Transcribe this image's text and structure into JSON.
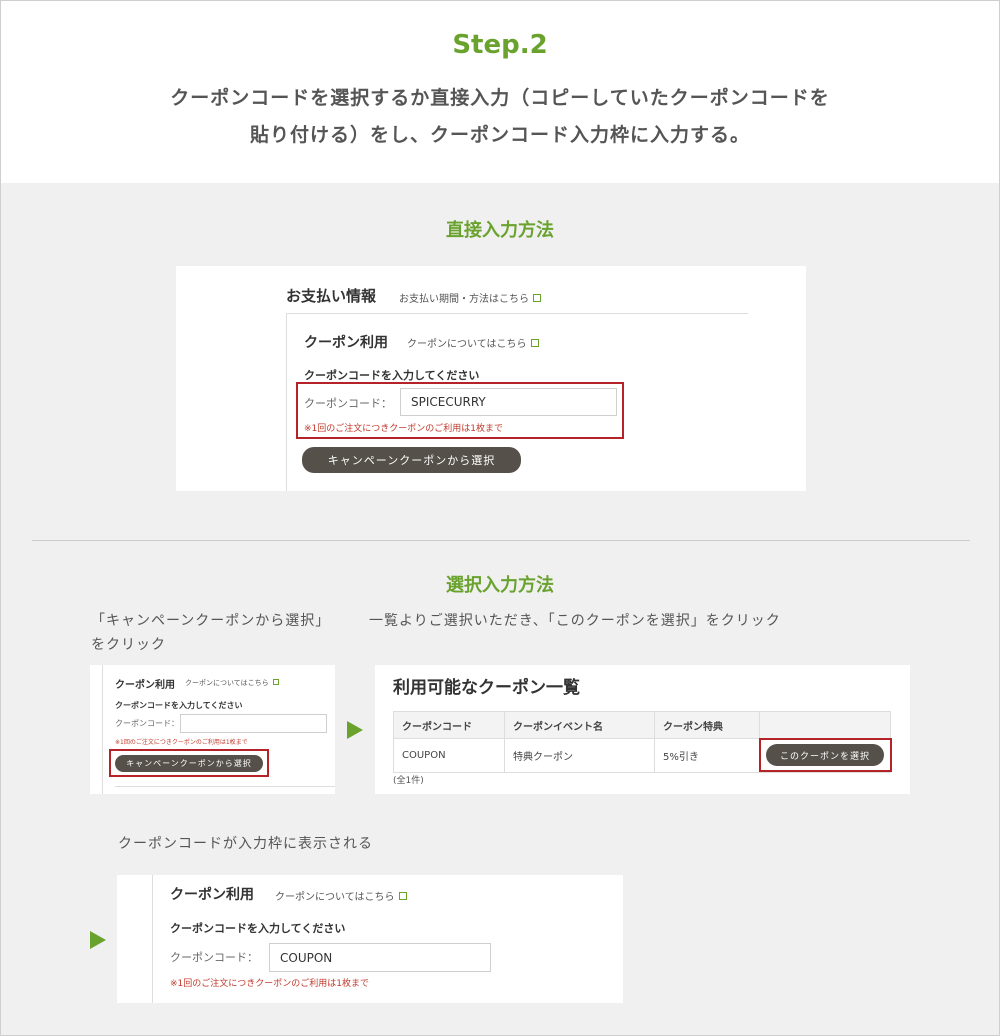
{
  "header": {
    "step": "Step.2",
    "intro_line1": "クーポンコードを選択するか直接入力（コピーしていたクーポンコードを",
    "intro_line2": "貼り付ける）をし、クーポンコード入力枠に入力する。"
  },
  "direct": {
    "title": "直接入力方法",
    "payment_title": "お支払い情報",
    "payment_link": "お支払い期間・方法はこちら",
    "coupon_title": "クーポン利用",
    "coupon_link": "クーポンについてはこちら",
    "prompt": "クーポンコードを入力してください",
    "field_label": "クーポンコード：",
    "field_value": "SPICECURRY",
    "note": "※1回のご注文につきクーポンのご利用は1枚まで",
    "campaign_button": "キャンペーンクーポンから選択"
  },
  "select": {
    "title": "選択入力方法",
    "caption_left_1": "「キャンペーンクーポンから選択」",
    "caption_left_2": "をクリック",
    "caption_right": "一覧よりご選択いただき、「このクーポンを選択」をクリック",
    "small_coupon_title": "クーポン利用",
    "small_coupon_link": "クーポンについてはこちら",
    "small_prompt": "クーポンコードを入力してください",
    "small_field_label": "クーポンコード：",
    "small_field_value": "",
    "small_note": "※1回のご注文につきクーポンのご利用は1枚まで",
    "small_button": "キャンペーンクーポンから選択",
    "list_title": "利用可能なクーポン一覧",
    "table": {
      "headers": [
        "クーポンコード",
        "クーポンイベント名",
        "クーポン特典",
        ""
      ],
      "row": [
        "COUPON",
        "特典クーポン",
        "5%引き"
      ],
      "select_button": "このクーポンを選択",
      "count": "(全1件)"
    }
  },
  "result": {
    "caption": "クーポンコードが入力枠に表示される",
    "coupon_title": "クーポン利用",
    "coupon_link": "クーポンについてはこちら",
    "prompt": "クーポンコードを入力してください",
    "field_label": "クーポンコード：",
    "field_value": "COUPON",
    "note": "※1回のご注文につきクーポンのご利用は1枚まで"
  },
  "colors": {
    "accent": "#6aa22e",
    "highlight": "#b52228",
    "button": "#55504a",
    "note": "#c0392b"
  }
}
